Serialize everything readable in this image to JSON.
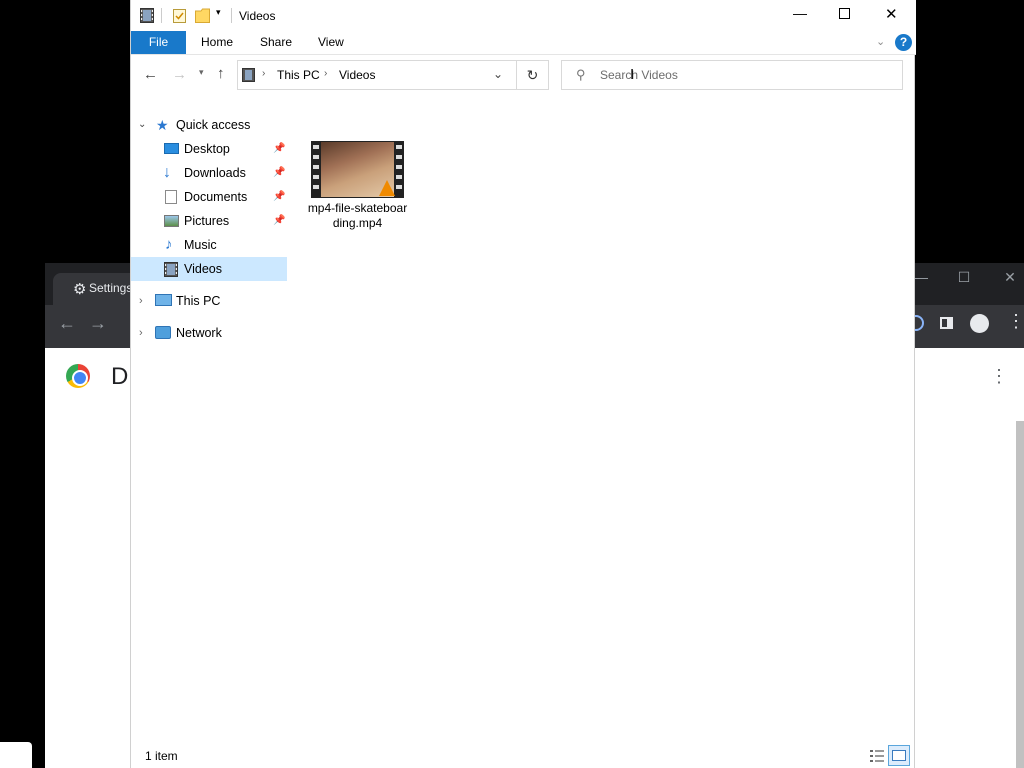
{
  "explorer": {
    "title": "Videos",
    "ribbon_tabs": {
      "file": "File",
      "home": "Home",
      "share": "Share",
      "view": "View"
    },
    "breadcrumb": {
      "root": "This PC",
      "current": "Videos"
    },
    "search": {
      "placeholder": "Search Videos"
    },
    "nav": {
      "quick_access": "Quick access",
      "items": [
        {
          "label": "Desktop",
          "pinned": true
        },
        {
          "label": "Downloads",
          "pinned": true
        },
        {
          "label": "Documents",
          "pinned": true
        },
        {
          "label": "Pictures",
          "pinned": true
        },
        {
          "label": "Music",
          "pinned": false
        },
        {
          "label": "Videos",
          "pinned": false,
          "selected": true
        }
      ],
      "this_pc": "This PC",
      "network": "Network"
    },
    "files": [
      {
        "name": "mp4-file-skateboarding.mp4",
        "icon": "video-thumbnail"
      }
    ],
    "status": {
      "count": "1 item"
    },
    "accent": "#1979ca",
    "selection": "#cce8ff"
  },
  "chrome_background": {
    "tab_title": "Settings",
    "page_letter": "D"
  }
}
